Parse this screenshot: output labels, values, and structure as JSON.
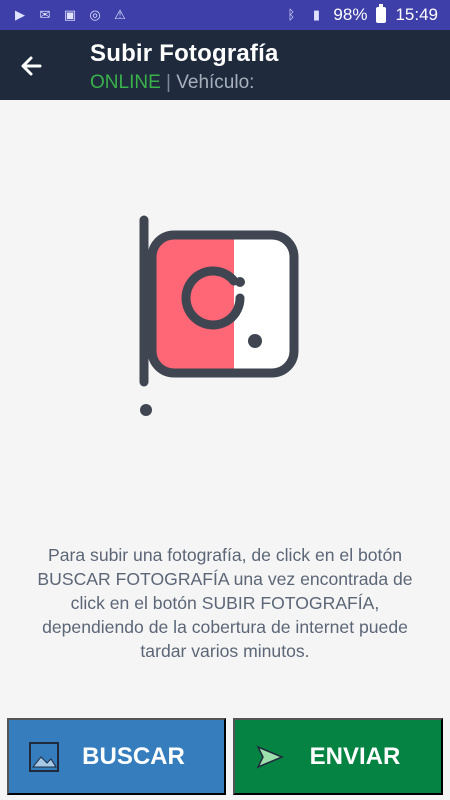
{
  "status_bar": {
    "battery": "98%",
    "time": "15:49",
    "icons": [
      "play-icon",
      "mail-icon",
      "image-icon",
      "sync-icon",
      "alert-icon",
      "bluetooth-icon",
      "signal-icon",
      "battery-icon"
    ]
  },
  "app_bar": {
    "title": "Subir Fotografía",
    "status_online": "ONLINE",
    "separator": "|",
    "vehicle_label": "Vehículo:"
  },
  "main": {
    "instruction": "Para subir una fotografía, de click en el botón BUSCAR FOTOGRAFÍA una vez encontrada de click en el botón SUBIR FOTOGRAFÍA, dependiendo de la cobertura de internet puede tardar varios minutos."
  },
  "buttons": {
    "search_label": "BUSCAR",
    "send_label": "ENVIAR"
  },
  "colors": {
    "status_bar": "#3f3faa",
    "app_bar": "#1f2b3d",
    "online": "#39b24a",
    "search_button": "#367dbe",
    "send_button": "#048342",
    "illustration_accent": "#ff6676"
  }
}
